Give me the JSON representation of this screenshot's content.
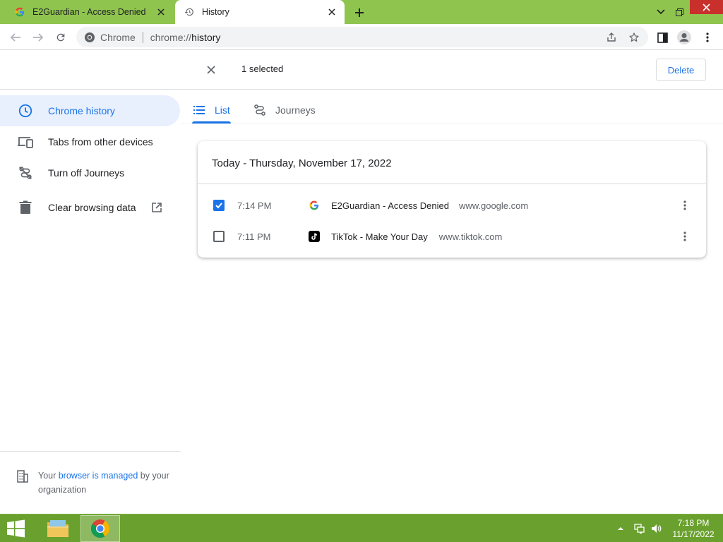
{
  "browser": {
    "tabs": [
      {
        "title": "E2Guardian - Access Denied",
        "favicon": "google-g-icon",
        "active": false
      },
      {
        "title": "History",
        "favicon": "history-icon",
        "active": true
      }
    ],
    "omnibox": {
      "chip": "Chrome",
      "url_scheme": "chrome://",
      "url_host": "history"
    }
  },
  "selection_bar": {
    "count_text": "1 selected",
    "delete_label": "Delete"
  },
  "sidebar": {
    "items": [
      {
        "label": "Chrome history",
        "icon": "clock-icon",
        "active": true
      },
      {
        "label": "Tabs from other devices",
        "icon": "devices-icon",
        "active": false
      },
      {
        "label": "Turn off Journeys",
        "icon": "journeys-off-icon",
        "active": false
      },
      {
        "label": "Clear browsing data",
        "icon": "trash-icon",
        "active": false,
        "external": true
      }
    ],
    "managed": {
      "prefix": "Your ",
      "link": "browser is managed",
      "suffix": " by your organization"
    }
  },
  "content_tabs": [
    {
      "label": "List",
      "icon": "list-icon",
      "active": true
    },
    {
      "label": "Journeys",
      "icon": "journeys-icon",
      "active": false
    }
  ],
  "history": {
    "date_heading": "Today - Thursday, November 17, 2022",
    "entries": [
      {
        "checked": true,
        "time": "7:14 PM",
        "favicon": "google-g-icon",
        "title": "E2Guardian - Access Denied",
        "domain": "www.google.com"
      },
      {
        "checked": false,
        "time": "7:11 PM",
        "favicon": "tiktok-icon",
        "title": "TikTok - Make Your Day",
        "domain": "www.tiktok.com"
      }
    ]
  },
  "taskbar": {
    "time": "7:18 PM",
    "date": "11/17/2022"
  },
  "colors": {
    "accent": "#1a73e8",
    "tabstrip": "#8fc44f",
    "taskbar": "#6aa12e"
  }
}
